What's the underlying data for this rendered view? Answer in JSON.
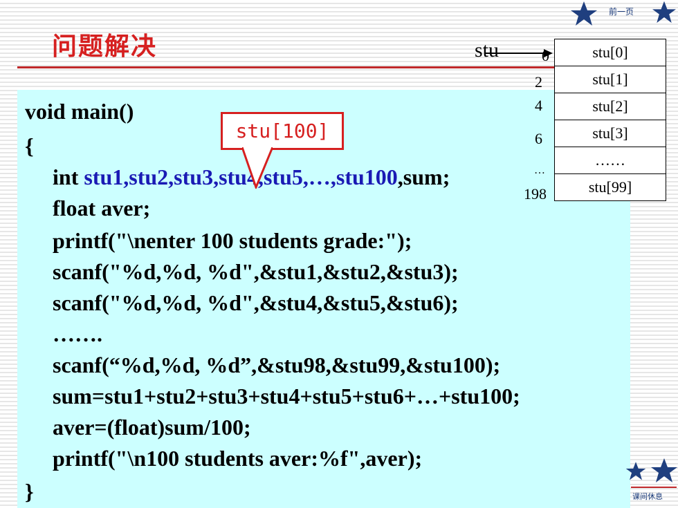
{
  "title": "问题解决",
  "nav": {
    "prev_label": "前一页",
    "rest_label": "课间休息"
  },
  "callout": "stu[100]",
  "memory": {
    "pointer_label": "stu",
    "cells": [
      "stu[0]",
      "stu[1]",
      "stu[2]",
      "stu[3]",
      "……",
      "stu[99]"
    ],
    "addresses": [
      "0",
      "2",
      "4",
      "6",
      "…",
      "198"
    ]
  },
  "code": {
    "line1": "void main()",
    "line2": "{",
    "line3_pre": "int ",
    "line3_vars": "stu1,stu2,stu3,stu4,stu5,…,stu100",
    "line3_post": ",sum;",
    "line4": "float aver;",
    "line5": "printf(\"\\nenter 100 students grade:\");",
    "line6": "scanf(\"%d,%d, %d\",&stu1,&stu2,&stu3);",
    "line7": "scanf(\"%d,%d, %d\",&stu4,&stu5,&stu6);",
    "line8": "…….",
    "line9": "scanf(“%d,%d, %d”,&stu98,&stu99,&stu100);",
    "line10": "sum=stu1+stu2+stu3+stu4+stu5+stu6+…+stu100;",
    "line11": "aver=(float)sum/100;",
    "line12": "printf(\"\\n100 students aver:%f\",aver);",
    "line13": "}"
  },
  "colors": {
    "title": "#d62020",
    "code_bg": "#ccffff",
    "var_blue": "#1a1ab4",
    "star": "#1f3f7f"
  }
}
